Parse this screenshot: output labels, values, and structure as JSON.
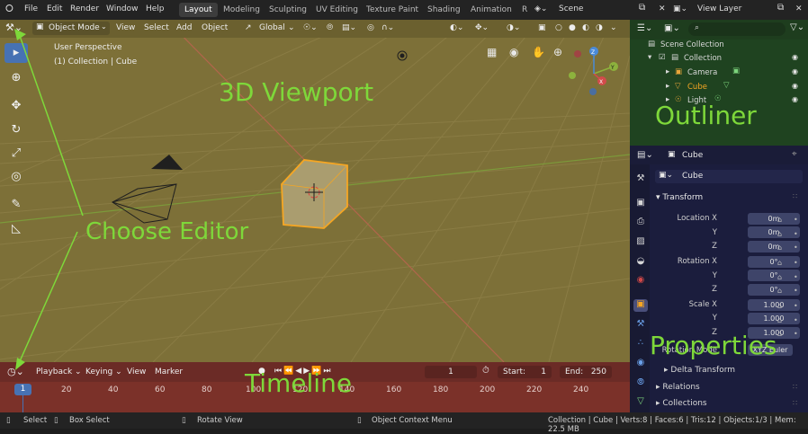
{
  "menu": {
    "logo": "blender-logo",
    "items": [
      "File",
      "Edit",
      "Render",
      "Window",
      "Help"
    ]
  },
  "workspaces": [
    "Layout",
    "Modeling",
    "Sculpting",
    "UV Editing",
    "Texture Paint",
    "Shading",
    "Animation",
    "R"
  ],
  "scene": {
    "label": "Scene",
    "view_layer": "View Layer"
  },
  "viewport": {
    "mode": "Object Mode",
    "menus": [
      "View",
      "Select",
      "Add",
      "Object"
    ],
    "transform_orientation": "Global",
    "overlay_line1": "User Perspective",
    "overlay_line2": "(1) Collection | Cube",
    "gizmo_axes": [
      "X",
      "Y",
      "Z"
    ]
  },
  "timeline": {
    "menus": [
      "Playback",
      "Keying",
      "View",
      "Marker"
    ],
    "current_frame": "1",
    "start_label": "Start:",
    "start": "1",
    "end_label": "End:",
    "end": "250",
    "ruler": [
      "1",
      "20",
      "40",
      "60",
      "80",
      "100",
      "120",
      "140",
      "160",
      "180",
      "200",
      "220",
      "240"
    ]
  },
  "outliner": {
    "rows": [
      {
        "label": "Scene Collection"
      },
      {
        "label": "Collection"
      },
      {
        "label": "Camera"
      },
      {
        "label": "Cube"
      },
      {
        "label": "Light"
      }
    ]
  },
  "properties": {
    "object": "Cube",
    "object_field": "Cube",
    "transform_label": "Transform",
    "location": {
      "x_label": "Location X",
      "y_label": "Y",
      "z_label": "Z",
      "x": "0m",
      "y": "0m",
      "z": "0m"
    },
    "rotation": {
      "x_label": "Rotation X",
      "y_label": "Y",
      "z_label": "Z",
      "x": "0°",
      "y": "0°",
      "z": "0°"
    },
    "scale": {
      "x_label": "Scale X",
      "y_label": "Y",
      "z_label": "Z",
      "x": "1.000",
      "y": "1.000",
      "z": "1.000"
    },
    "rotation_mode_label": "Rotation Mode",
    "rotation_mode": "XYZ Euler",
    "delta_label": "Delta Transform",
    "relations_label": "Relations",
    "collections_label": "Collections"
  },
  "status": {
    "select": "Select",
    "box_select": "Box Select",
    "rotate_view": "Rotate View",
    "context_menu": "Object Context Menu",
    "info": "Collection | Cube | Verts:8 | Faces:6 | Tris:12 | Objects:1/3 | Mem: 22.5 MB"
  },
  "annotations": {
    "viewport": "3D Viewport",
    "outliner": "Outliner",
    "choose_editor": "Choose Editor",
    "timeline": "Timeline",
    "properties": "Properties"
  },
  "colors": {
    "viewport": "#7d7038",
    "timeline": "#7b3129",
    "outliner": "#1f4320",
    "properties": "#1b1d3d",
    "annotation": "#7ed83a",
    "selected": "#f5a623"
  }
}
